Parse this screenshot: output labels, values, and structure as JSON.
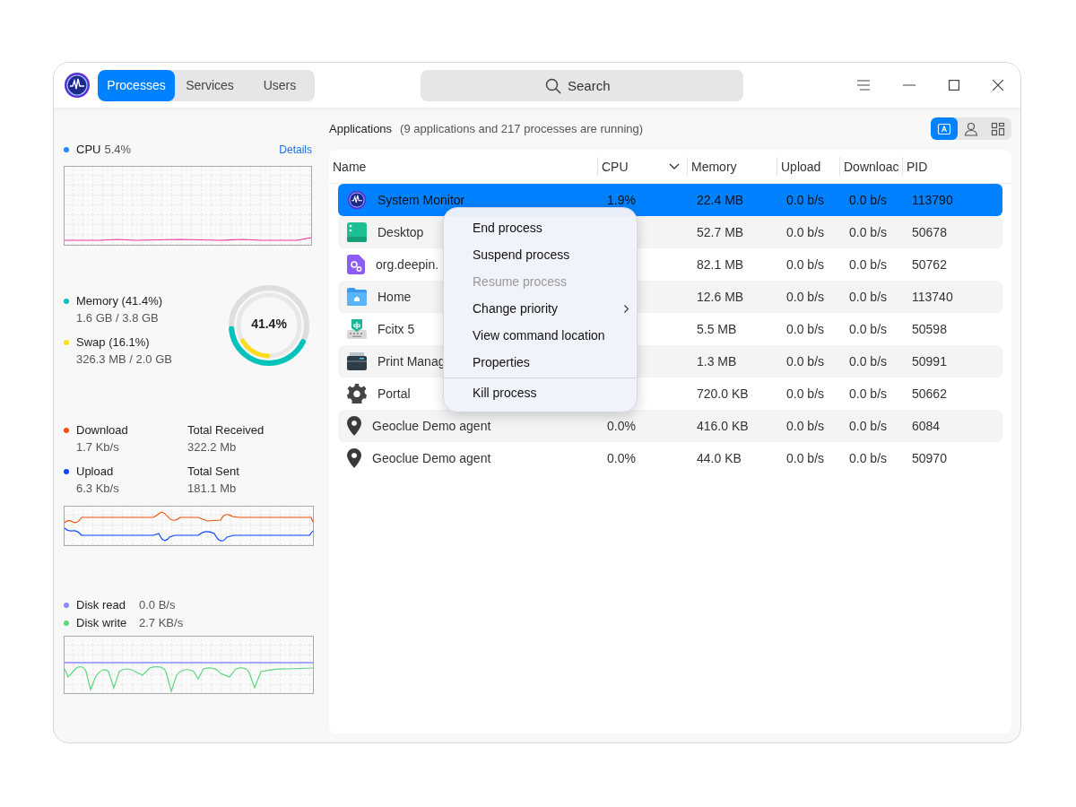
{
  "tabs": [
    {
      "label": "Processes",
      "selected": true
    },
    {
      "label": "Services",
      "selected": false
    },
    {
      "label": "Users",
      "selected": false
    }
  ],
  "search": {
    "placeholder": "Search"
  },
  "sidebar": {
    "cpu": {
      "label": "CPU",
      "value": "5.4%",
      "color": "#1e88ff",
      "details": "Details"
    },
    "memory": {
      "center": "41.4%",
      "items": [
        {
          "label": "Memory (41.4%)",
          "value": "1.6 GB / 3.8 GB",
          "color": "#00c3bc",
          "level": 0.414
        },
        {
          "label": "Swap (16.1%)",
          "value": "326.3 MB / 2.0 GB",
          "color": "#ffdc1e",
          "level": 0.161
        }
      ]
    },
    "network": [
      {
        "label": "Download",
        "value": "1.7 Kb/s",
        "color": "#f0500a",
        "total_label": "Total Received",
        "total": "322.2 Mb"
      },
      {
        "label": "Upload",
        "value": "6.3 Kb/s",
        "color": "#0a46ff",
        "total_label": "Total Sent",
        "total": "181.1 Mb"
      }
    ],
    "disk": [
      {
        "label": "Disk read",
        "value": "0.0 B/s",
        "color": "#8a8aff"
      },
      {
        "label": "Disk write",
        "value": "2.7 KB/s",
        "color": "#5ed681"
      }
    ]
  },
  "header": {
    "title": "Applications",
    "summary": "(9 applications and 217 processes are running)",
    "views": [
      {
        "kind": "apps",
        "selected": true
      },
      {
        "kind": "user",
        "selected": false
      },
      {
        "kind": "all",
        "selected": false
      }
    ]
  },
  "table": {
    "columns": [
      "Name",
      "CPU",
      "Memory",
      "Upload",
      "Downloac",
      "PID"
    ],
    "rows": [
      {
        "kind": "monitor",
        "name": "System Monitor",
        "cpu": "1.9%",
        "memory": "22.4 MB",
        "upload": "0.0 b/s",
        "download": "0.0 b/s",
        "pid": "113790",
        "selected": true
      },
      {
        "kind": "desktop",
        "name": "Desktop",
        "memory": "52.7 MB",
        "upload": "0.0 b/s",
        "download": "0.0 b/s",
        "pid": "50678",
        "selected": false
      },
      {
        "kind": "settings",
        "name": "org.deepin.",
        "memory": "82.1 MB",
        "upload": "0.0 b/s",
        "download": "0.0 b/s",
        "pid": "50762",
        "selected": false
      },
      {
        "kind": "folder",
        "name": "Home",
        "memory": "12.6 MB",
        "upload": "0.0 b/s",
        "download": "0.0 b/s",
        "pid": "113740",
        "selected": false
      },
      {
        "kind": "keyboard",
        "name": "Fcitx 5",
        "memory": "5.5 MB",
        "upload": "0.0 b/s",
        "download": "0.0 b/s",
        "pid": "50598",
        "selected": false
      },
      {
        "kind": "printer",
        "name": "Print Manag",
        "memory": "1.3 MB",
        "upload": "0.0 b/s",
        "download": "0.0 b/s",
        "pid": "50991",
        "selected": false
      },
      {
        "kind": "gear",
        "name": "Portal",
        "memory": "720.0 KB",
        "upload": "0.0 b/s",
        "download": "0.0 b/s",
        "pid": "50662",
        "selected": false
      },
      {
        "kind": "pin",
        "name": "Geoclue Demo agent",
        "cpu": "0.0%",
        "memory": "416.0 KB",
        "upload": "0.0 b/s",
        "download": "0.0 b/s",
        "pid": "6084",
        "selected": false
      },
      {
        "kind": "pin",
        "name": "Geoclue Demo agent",
        "cpu": "0.0%",
        "memory": "44.0 KB",
        "upload": "0.0 b/s",
        "download": "0.0 b/s",
        "pid": "50970",
        "selected": false
      }
    ]
  },
  "context_menu": [
    {
      "label": "End process",
      "disabled": false,
      "submenu": false,
      "separator_before": false
    },
    {
      "label": "Suspend process",
      "disabled": false,
      "submenu": false,
      "separator_before": false
    },
    {
      "label": "Resume process",
      "disabled": true,
      "submenu": false,
      "separator_before": false
    },
    {
      "label": "Change priority",
      "disabled": false,
      "submenu": true,
      "separator_before": false
    },
    {
      "label": "View command location",
      "disabled": false,
      "submenu": false,
      "separator_before": false
    },
    {
      "label": "Properties",
      "disabled": false,
      "submenu": false,
      "separator_before": false
    },
    {
      "label": "Kill process",
      "disabled": false,
      "submenu": false,
      "separator_before": true
    }
  ]
}
